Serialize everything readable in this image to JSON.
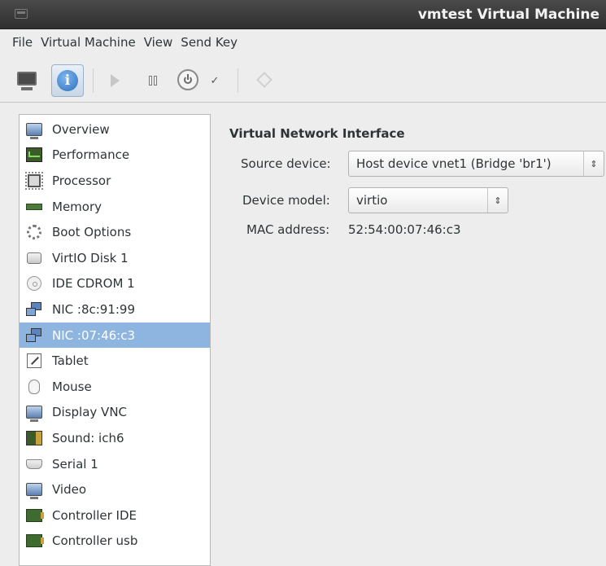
{
  "window": {
    "title": "vmtest Virtual Machine",
    "icon": "window-icon"
  },
  "menubar": {
    "items": [
      {
        "label": "File"
      },
      {
        "label": "Virtual Machine"
      },
      {
        "label": "View"
      },
      {
        "label": "Send Key"
      }
    ]
  },
  "toolbar": {
    "buttons": [
      {
        "icon": "console-monitor-icon",
        "state": "normal"
      },
      {
        "icon": "info-icon",
        "state": "active"
      },
      {
        "icon": "run-icon",
        "state": "disabled"
      },
      {
        "icon": "pause-icon",
        "state": "normal"
      },
      {
        "icon": "power-icon",
        "state": "normal"
      },
      {
        "icon": "chevron-down-icon",
        "state": "normal"
      },
      {
        "icon": "fullscreen-move-icon",
        "state": "disabled"
      }
    ]
  },
  "hardware_list": {
    "items": [
      {
        "label": "Overview",
        "icon": "monitor-icon"
      },
      {
        "label": "Performance",
        "icon": "performance-icon"
      },
      {
        "label": "Processor",
        "icon": "processor-icon"
      },
      {
        "label": "Memory",
        "icon": "memory-icon"
      },
      {
        "label": "Boot Options",
        "icon": "gears-icon"
      },
      {
        "label": "VirtIO Disk 1",
        "icon": "disk-icon"
      },
      {
        "label": "IDE CDROM 1",
        "icon": "cdrom-icon"
      },
      {
        "label": "NIC :8c:91:99",
        "icon": "network-icon"
      },
      {
        "label": "NIC :07:46:c3",
        "icon": "network-icon",
        "selected": true
      },
      {
        "label": "Tablet",
        "icon": "tablet-icon"
      },
      {
        "label": "Mouse",
        "icon": "mouse-icon"
      },
      {
        "label": "Display VNC",
        "icon": "display-icon"
      },
      {
        "label": "Sound: ich6",
        "icon": "sound-card-icon"
      },
      {
        "label": "Serial 1",
        "icon": "serial-icon"
      },
      {
        "label": "Video",
        "icon": "video-icon"
      },
      {
        "label": "Controller IDE",
        "icon": "controller-icon"
      },
      {
        "label": "Controller usb",
        "icon": "controller-icon"
      }
    ],
    "selected_color": "#8db5e0"
  },
  "details": {
    "section_title": "Virtual Network Interface",
    "source_device": {
      "label": "Source device:",
      "value": "Host device vnet1 (Bridge 'br1')"
    },
    "device_model": {
      "label": "Device model:",
      "value": "virtio"
    },
    "mac_address": {
      "label": "MAC address:",
      "value": "52:54:00:07:46:c3"
    }
  }
}
